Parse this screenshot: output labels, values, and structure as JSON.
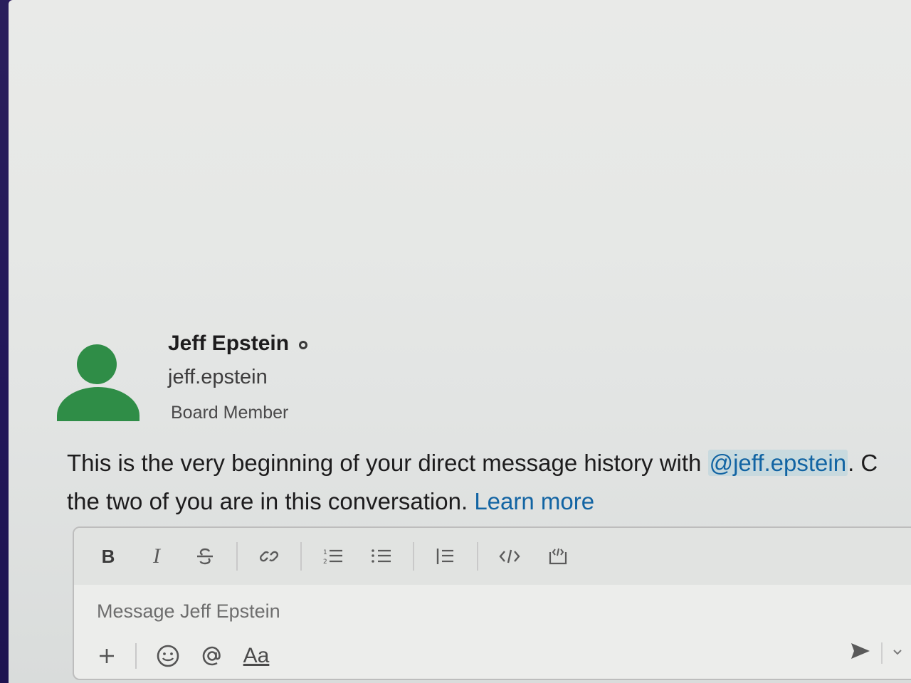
{
  "profile": {
    "display_name": "Jeff Epstein",
    "username": "jeff.epstein",
    "title": "Board Member",
    "presence": "away",
    "avatar_color": "#2f8d47"
  },
  "intro": {
    "text_before": "This is the very beginning of your direct message history with ",
    "mention": "@jeff.epstein",
    "text_after": ". C",
    "line2": "the two of you are in this conversation. ",
    "learn_more": "Learn more"
  },
  "composer": {
    "placeholder": "Message Jeff Epstein",
    "format_buttons": [
      "bold",
      "italic",
      "strikethrough",
      "link",
      "ordered-list",
      "bulleted-list",
      "blockquote",
      "code",
      "code-block"
    ],
    "bold_label": "B",
    "italic_label": "I",
    "format_text_label": "Aa"
  },
  "colors": {
    "link": "#1264a3",
    "sidebar": "#2a1f5c"
  }
}
